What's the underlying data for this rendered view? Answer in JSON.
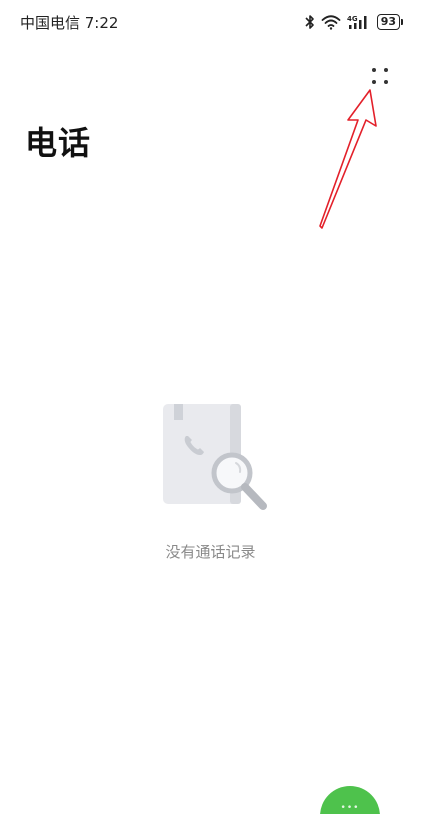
{
  "status_bar": {
    "carrier_time": "中国电信 7:22",
    "battery_level": "93",
    "network": "4G",
    "icons": [
      "bluetooth-icon",
      "wifi-icon",
      "cellular-signal-icon",
      "battery-icon"
    ]
  },
  "header": {
    "title": "电话",
    "more_icon": "more-dots-icon"
  },
  "empty_state": {
    "message": "没有通话记录",
    "illustration": "call-log-search-icon"
  },
  "fab": {
    "icon": "dialpad-icon"
  },
  "colors": {
    "background": "#ffffff",
    "title": "#111111",
    "muted_text": "#8a8a8a",
    "fab_green": "#4ec24c",
    "annotation_red": "#e3202a"
  }
}
